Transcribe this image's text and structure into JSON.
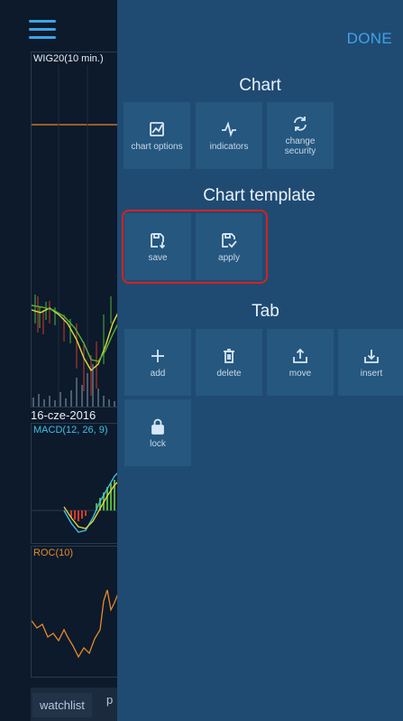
{
  "chart_pane": {
    "top_panel_title": "WIG20(10 min.)",
    "date_label": "16-cze-2016",
    "macd_title": "MACD(12, 26, 9)",
    "roc_title": "ROC(10)",
    "bottom_tab_label": "watchlist",
    "bottom_tab_next": "p"
  },
  "menu": {
    "done_label": "DONE",
    "chart_section": {
      "title": "Chart",
      "items": [
        {
          "label": "chart options",
          "icon": "chart-options-icon"
        },
        {
          "label": "indicators",
          "icon": "indicators-icon"
        },
        {
          "label": "change security",
          "icon": "change-security-icon"
        }
      ]
    },
    "template_section": {
      "title": "Chart template",
      "items": [
        {
          "label": "save",
          "icon": "save-template-icon"
        },
        {
          "label": "apply",
          "icon": "apply-template-icon"
        }
      ]
    },
    "tab_section": {
      "title": "Tab",
      "items": [
        {
          "label": "add",
          "icon": "plus-icon"
        },
        {
          "label": "delete",
          "icon": "trash-icon"
        },
        {
          "label": "move",
          "icon": "move-icon"
        },
        {
          "label": "insert",
          "icon": "insert-icon"
        },
        {
          "label": "lock",
          "icon": "lock-icon"
        }
      ]
    }
  },
  "colors": {
    "accent": "#3ea3e8",
    "menu_background": "#1f4b73",
    "tile_background": "#25577f",
    "highlight": "#d9211f",
    "chart_orange": "#e6892a",
    "chart_green": "#55b13f",
    "chart_red": "#d43b2a"
  }
}
